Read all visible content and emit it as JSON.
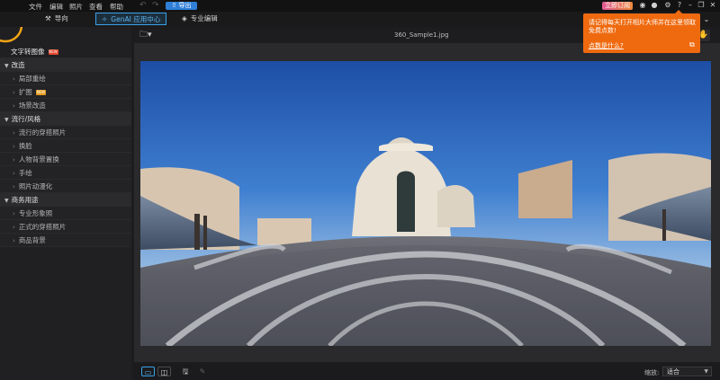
{
  "menu": [
    "文件",
    "编辑",
    "照片",
    "查看",
    "帮助"
  ],
  "toolbar": {
    "export_label": "导出",
    "subscribe_label": "立即订阅",
    "help_glyph": "?"
  },
  "modes": {
    "guide": "导向",
    "genai": "GenAI 应用中心",
    "pro": "专业编辑"
  },
  "sidebar": {
    "top_item": {
      "label": "文字转图像",
      "badge": "NEW"
    },
    "sections": [
      {
        "title": "改造",
        "items": [
          {
            "label": "局部重绘"
          },
          {
            "label": "扩图",
            "badge": "NEW"
          },
          {
            "label": "场景改造"
          }
        ]
      },
      {
        "title": "流行/风格",
        "items": [
          {
            "label": "流行的穿搭照片"
          },
          {
            "label": "换脸"
          },
          {
            "label": "人物背景置换"
          },
          {
            "label": "手绘"
          },
          {
            "label": "照片动漫化"
          }
        ]
      },
      {
        "title": "商务用途",
        "items": [
          {
            "label": "专业形象照"
          },
          {
            "label": "正式的穿搭照片"
          },
          {
            "label": "商品背景"
          }
        ]
      }
    ]
  },
  "canvas": {
    "filename": "360_Sample1.jpg"
  },
  "bottom": {
    "zoom_label": "缩放:",
    "zoom_value": "适合"
  },
  "notification": {
    "message": "请记得每天打开相片大师并在这里领取免费点数!",
    "link": "点数是什么?"
  },
  "colors": {
    "accent": "#3aa0e8",
    "toast": "#ef6a0f",
    "export": "#2f7fd9",
    "badge_new": "#e3492f"
  }
}
